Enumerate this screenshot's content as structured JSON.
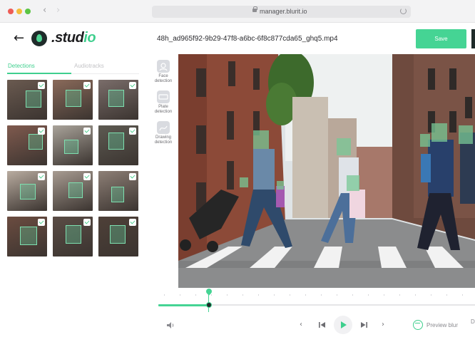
{
  "browser": {
    "url": "manager.blurit.io"
  },
  "header": {
    "logo_dot": ".",
    "logo_main": "stud",
    "logo_accent": "io",
    "file_name": "48h_ad965f92-9b29-47f8-a6bc-6f8c877cda65_ghq5.mp4",
    "save_label": "Save"
  },
  "sidebar": {
    "tabs": [
      {
        "label": "Detections",
        "active": true
      },
      {
        "label": "Audiotracks",
        "active": false
      }
    ],
    "thumbnails": [
      {
        "label": "face-1",
        "bg": "#6a5a50",
        "checked": true
      },
      {
        "label": "face-2",
        "bg": "#8a6a5a",
        "checked": true
      },
      {
        "label": "face-3",
        "bg": "#7a6d6a",
        "checked": true
      },
      {
        "label": "face-4",
        "bg": "#7f5a4e",
        "checked": true
      },
      {
        "label": "face-5",
        "bg": "#a9a39a",
        "checked": true
      },
      {
        "label": "face-6",
        "bg": "#5d5a52",
        "checked": true
      },
      {
        "label": "face-7",
        "bg": "#b9aca0",
        "checked": true
      },
      {
        "label": "face-8",
        "bg": "#a89c92",
        "checked": true
      },
      {
        "label": "face-9",
        "bg": "#8d7f76",
        "checked": true
      },
      {
        "label": "face-10",
        "bg": "#6b4c40",
        "checked": true
      },
      {
        "label": "face-11",
        "bg": "#5a4c45",
        "checked": true
      },
      {
        "label": "face-12",
        "bg": "#4e4038",
        "checked": true
      }
    ]
  },
  "tools": [
    {
      "line1": "Face",
      "line2": "detection"
    },
    {
      "line1": "Plate",
      "line2": "detection"
    },
    {
      "line1": "Drawing",
      "line2": "detection"
    }
  ],
  "controls": {
    "preview_label": "Preview blur",
    "cut_label": "D"
  },
  "colors": {
    "accent": "#45d494",
    "dark": "#1f2b2a"
  },
  "timeline": {
    "progress": 0.16
  }
}
